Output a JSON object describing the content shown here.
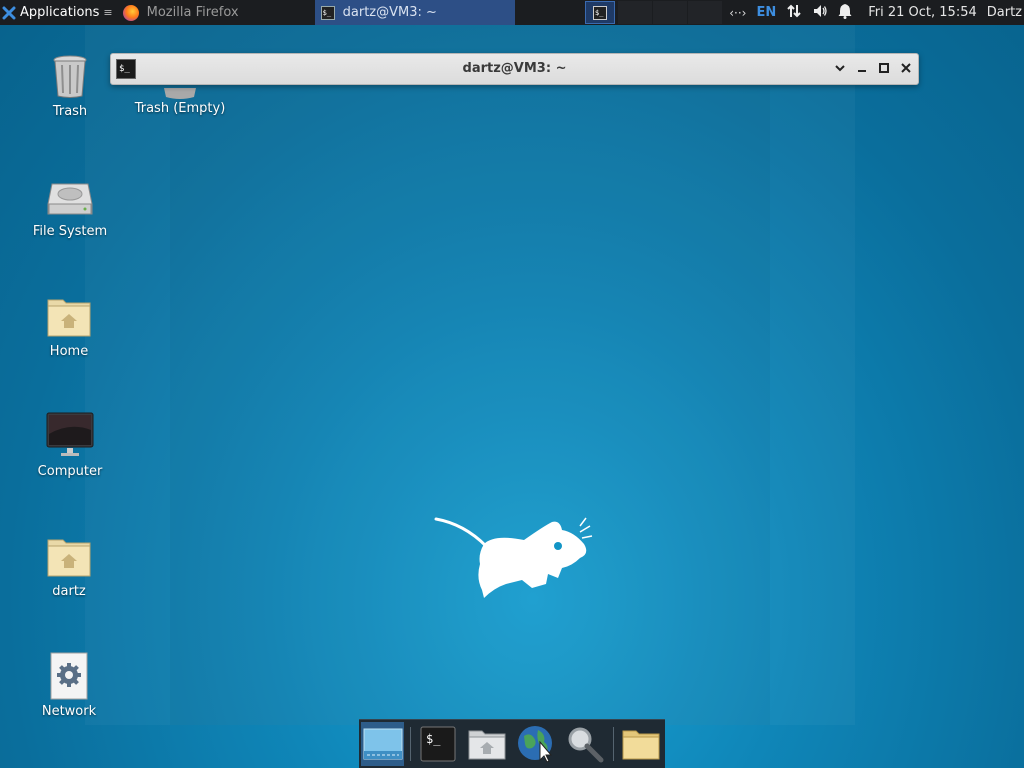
{
  "panel": {
    "applications_label": "Applications",
    "tasks": [
      {
        "label": "Mozilla Firefox",
        "icon": "firefox-icon",
        "active": false
      },
      {
        "label": "dartz@VM3: ~",
        "icon": "terminal-icon",
        "active": true
      }
    ],
    "tray": {
      "keyboard_layout": "EN",
      "clock": "Fri 21 Oct, 15:54",
      "user": "Dartz"
    }
  },
  "window": {
    "title": "dartz@VM3: ~",
    "buttons": [
      "chevron-down-icon",
      "minimize-icon",
      "maximize-icon",
      "close-icon"
    ]
  },
  "desktop": {
    "icons": [
      {
        "label": "Trash",
        "icon": "trash-icon"
      },
      {
        "label": "Trash (Empty)",
        "icon": "trash-icon"
      },
      {
        "label": "File System",
        "icon": "hard-drive-icon"
      },
      {
        "label": "Home",
        "icon": "home-folder-icon"
      },
      {
        "label": "Computer",
        "icon": "monitor-icon"
      },
      {
        "label": "dartz",
        "icon": "home-folder-icon"
      },
      {
        "label": "Network",
        "icon": "network-settings-icon"
      }
    ]
  },
  "dock": {
    "items": [
      "show-desktop-icon",
      "terminal-icon",
      "home-folder-icon",
      "web-browser-icon",
      "search-icon",
      "folder-icon"
    ]
  },
  "colors": {
    "panel_bg": "#1b1d20",
    "active_task": "#2d4f86",
    "accent_en": "#3d8ee0",
    "wallpaper": "#0f86b8"
  }
}
